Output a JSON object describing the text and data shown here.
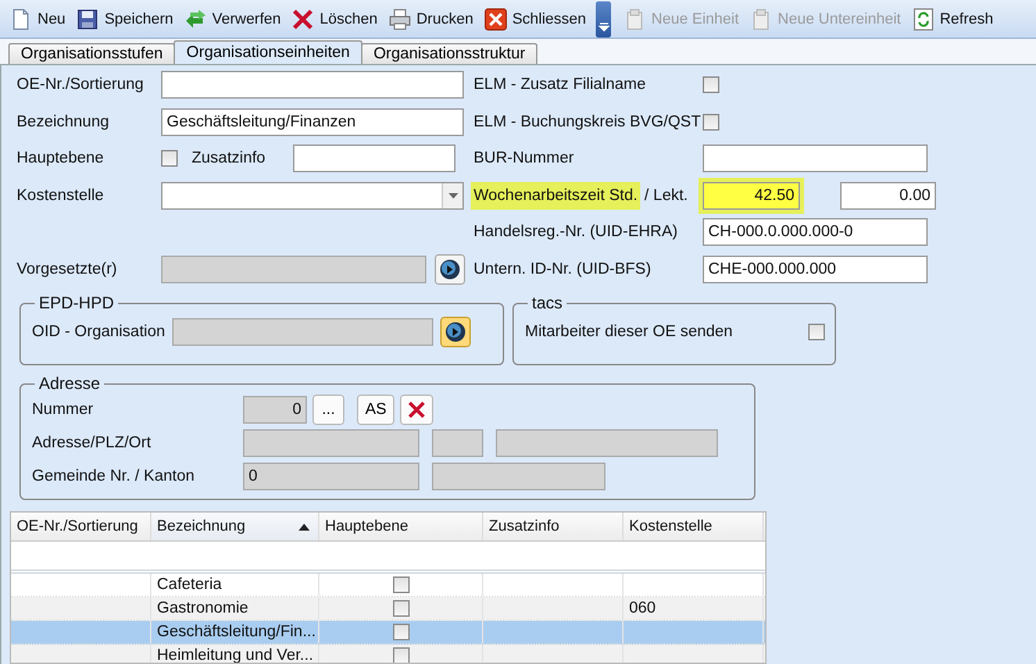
{
  "toolbar": [
    {
      "kind": "button",
      "label": "Neu",
      "disabled": false
    },
    {
      "kind": "button",
      "label": "Speichern",
      "disabled": false
    },
    {
      "kind": "button",
      "label": "Verwerfen",
      "disabled": false
    },
    {
      "kind": "button",
      "label": "Löschen",
      "disabled": false
    },
    {
      "kind": "button",
      "label": "Drucken",
      "disabled": false
    },
    {
      "kind": "button",
      "label": "Schliessen",
      "disabled": false
    },
    {
      "kind": "overflow"
    },
    {
      "kind": "button",
      "label": "Neue Einheit",
      "disabled": true
    },
    {
      "kind": "button",
      "label": "Neue Untereinheit",
      "disabled": true
    },
    {
      "kind": "button",
      "label": "Refresh",
      "disabled": false
    }
  ],
  "tabs": [
    {
      "label": "Organisationsstufen",
      "selected": false
    },
    {
      "label": "Organisationseinheiten",
      "selected": true
    },
    {
      "label": "Organisationsstruktur",
      "selected": false
    }
  ],
  "form": {
    "left": [
      {
        "kind": "text",
        "label": "OE-Nr./Sortierung"
      },
      {
        "kind": "text",
        "label": "Bezeichnung",
        "value": "Geschäftsleitung/Finanzen"
      },
      {
        "kind": "check_text",
        "label": "Hauptebene",
        "checked": false,
        "sub_label": "Zusatzinfo"
      },
      {
        "kind": "combo",
        "label": "Kostenstelle"
      },
      {
        "kind": "empty"
      },
      {
        "kind": "lookup",
        "label": "Vorgesetzte(r)"
      }
    ],
    "right": [
      {
        "kind": "checkbox",
        "label": "ELM - Zusatz Filialname",
        "checked": false
      },
      {
        "kind": "checkbox",
        "label": "ELM - Buchungskreis BVG/QST",
        "checked": false
      },
      {
        "kind": "text",
        "label": "BUR-Nummer"
      },
      {
        "kind": "pair",
        "label": "Wochenarbeitszeit Std.",
        "label_rest": "/ Lekt.",
        "highlighted": true,
        "value": "42.50",
        "value_2": "0.00"
      },
      {
        "kind": "text",
        "label": "Handelsreg.-Nr. (UID-EHRA)",
        "value": "CH-000.0.000.000-0"
      },
      {
        "kind": "text",
        "label": "Untern. ID-Nr. (UID-BFS)",
        "value": "CHE-000.000.000"
      }
    ]
  },
  "epd_hpd": {
    "title": "EPD-HPD",
    "label": "OID - Organisation",
    "button_focused": true
  },
  "tacs": {
    "title": "tacs",
    "label": "Mitarbeiter dieser OE senden",
    "checked": false
  },
  "address": {
    "title": "Adresse",
    "number_label": "Nummer",
    "number": "0",
    "browse_button": "...",
    "as_button": "AS",
    "address_label": "Adresse/PLZ/Ort",
    "municipality_label": "Gemeinde Nr. / Kanton",
    "municipality": "0"
  },
  "table": {
    "columns": [
      {
        "label": "OE-Nr./Sortierung",
        "sorted": false
      },
      {
        "label": "Bezeichnung",
        "sorted": true
      },
      {
        "label": "Hauptebene",
        "sorted": false
      },
      {
        "label": "Zusatzinfo",
        "sorted": false
      },
      {
        "label": "Kostenstelle",
        "sorted": false
      }
    ],
    "rows": [
      {
        "name": "Cafeteria",
        "main_level": false,
        "selected": false
      },
      {
        "name": "Gastronomie",
        "main_level": false,
        "cost_center": "060",
        "selected": false
      },
      {
        "name": "Geschäftsleitung/Fin...",
        "main_level": false,
        "selected": true
      },
      {
        "name": "Heimleitung und Ver...",
        "main_level": false,
        "selected": false
      }
    ]
  }
}
